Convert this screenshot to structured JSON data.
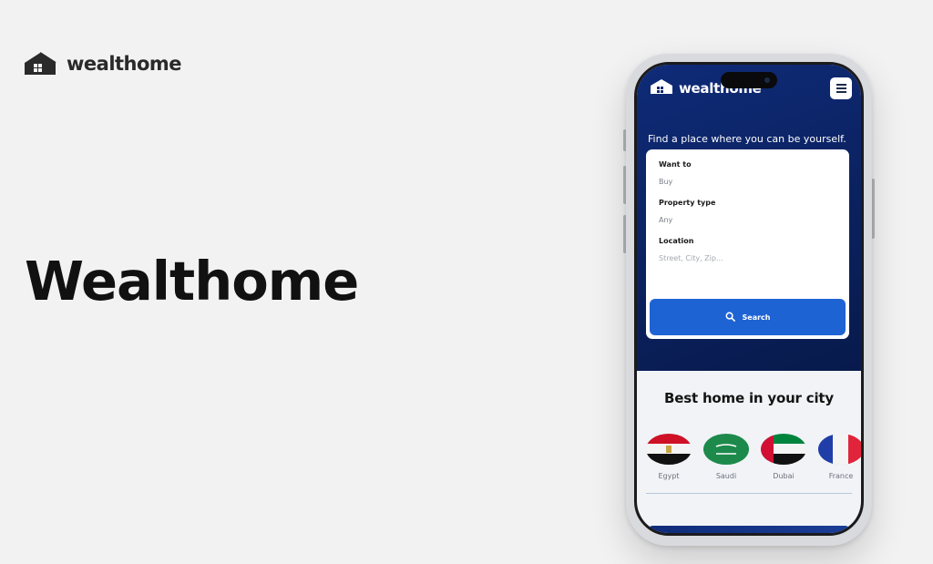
{
  "brand": {
    "name": "wealthome",
    "icon": "house-icon"
  },
  "hero": {
    "title": "Wealthome"
  },
  "app": {
    "brand_name": "wealthome",
    "menu_icon": "hamburger-icon",
    "tagline": "Find a place where you can be yourself.",
    "search": {
      "want_label": "Want to",
      "want_value": "Buy",
      "type_label": "Property type",
      "type_value": "Any",
      "location_label": "Location",
      "location_placeholder": "Street, City, Zip...",
      "button_label": "Search"
    },
    "section_title": "Best home in your city",
    "cities": [
      {
        "name": "Egypt"
      },
      {
        "name": "Saudi"
      },
      {
        "name": "Dubai"
      },
      {
        "name": "France"
      }
    ]
  },
  "colors": {
    "accent": "#1e63d4",
    "hero_bg": "#0c2466",
    "page_bg": "#f2f2f3"
  }
}
